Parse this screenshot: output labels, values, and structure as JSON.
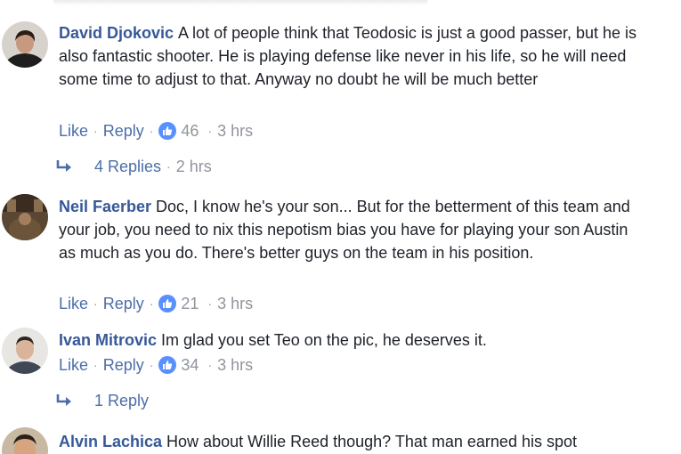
{
  "comments": [
    {
      "author": "David Djokovic",
      "text": "A lot of people think that Teodosic is just a good passer, but he is also fantastic shooter. He is playing defense like never in his life, so he will need some time to adjust to that. Anyway no doubt he will be much better",
      "like_label": "Like",
      "reply_label": "Reply",
      "reactions": "46",
      "time": "3 hrs",
      "replies_label": "4 Replies",
      "replies_time": "2 hrs"
    },
    {
      "author": "Neil Faerber",
      "text": "Doc, I know he's your son... But for the betterment of this team and your job, you need to nix this nepotism bias you have for playing your son Austin as much as you do. There's better guys on the team in his position.",
      "like_label": "Like",
      "reply_label": "Reply",
      "reactions": "21",
      "time": "3 hrs"
    },
    {
      "author": "Ivan Mitrovic",
      "text": "Im glad you set Teo on the pic, he deserves it.",
      "like_label": "Like",
      "reply_label": "Reply",
      "reactions": "34",
      "time": "3 hrs",
      "replies_label": "1 Reply"
    },
    {
      "author": "Alvin Lachica",
      "text": "How about Willie Reed though? That man earned his spot"
    }
  ],
  "colors": {
    "author": "#365899",
    "action_link": "#4b6ea8",
    "meta": "#90949c",
    "like_badge": "#5890ff"
  },
  "icons": {
    "like": "thumbs-up-icon",
    "reply_arrow": "reply-arrow-icon"
  }
}
